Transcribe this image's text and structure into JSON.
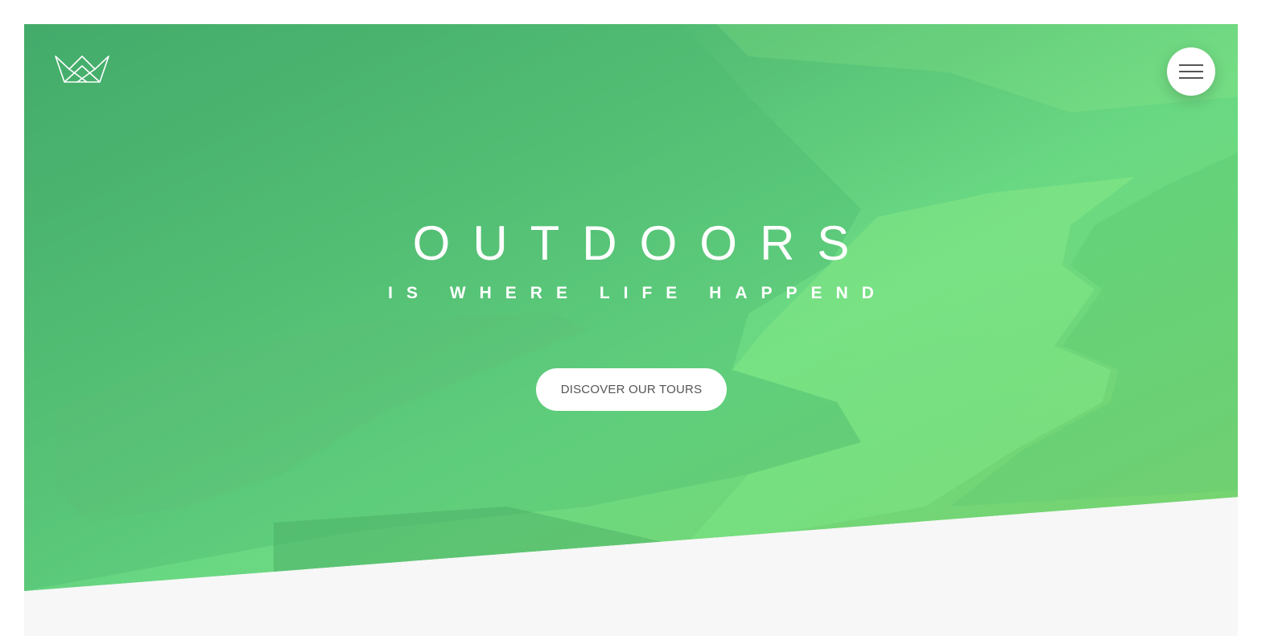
{
  "header": {
    "logo_icon": "crown-outline-logo",
    "menu_icon": "hamburger-menu-icon"
  },
  "hero": {
    "title": "OUTDOORS",
    "subtitle": "IS WHERE LIFE HAPPEND",
    "cta_label": "DISCOVER OUR TOURS",
    "background_description_icon": "fjord-landscape-image"
  },
  "colors": {
    "gradient_start": "#3fa86a",
    "gradient_end": "#7fd56f",
    "page_background": "#f7f7f7",
    "button_text": "#555555"
  }
}
